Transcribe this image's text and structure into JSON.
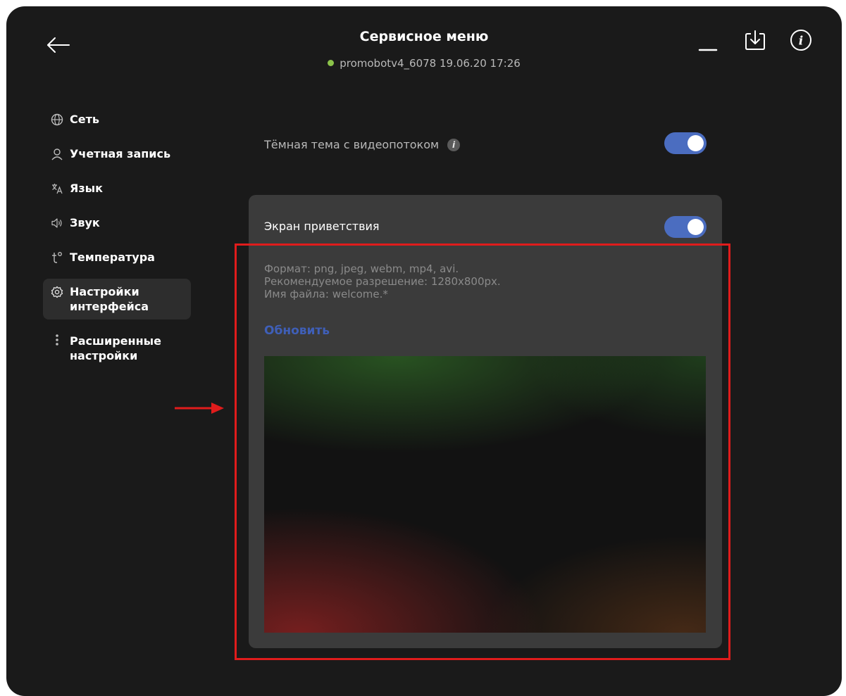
{
  "header": {
    "title": "Сервисное меню",
    "status_dot_color": "#8bc34a",
    "device_status": "promobotv4_6078 19.06.20  17:26",
    "icons": [
      "back-arrow-icon",
      "minimize-icon",
      "download-icon",
      "info-icon"
    ]
  },
  "sidebar": {
    "items": [
      {
        "label": "Сеть",
        "icon": "globe-icon",
        "active": false
      },
      {
        "label": "Учетная запись",
        "icon": "user-icon",
        "active": false
      },
      {
        "label": "Язык",
        "icon": "translate-icon",
        "active": false
      },
      {
        "label": "Звук",
        "icon": "speaker-icon",
        "active": false
      },
      {
        "label": "Температура",
        "icon": "temperature-icon",
        "active": false
      },
      {
        "label": "Настройки\nинтерфейса",
        "icon": "gear-icon",
        "active": true
      },
      {
        "label": "Расширенные\nнастройки",
        "icon": "more-vertical-icon",
        "active": false
      }
    ]
  },
  "settings": {
    "dark_theme": {
      "label": "Тёмная тема с видеопотоком",
      "info_glyph": "i",
      "enabled": true
    },
    "welcome_screen": {
      "label": "Экран приветствия",
      "enabled": true,
      "format_line": "Формат: png, jpeg, webm, mp4, avi.",
      "resolution_line": "Рекомендуемое разрешение: 1280x800px.",
      "filename_line": "Имя файла: welcome.*",
      "update_label": "Обновить"
    }
  },
  "colors": {
    "background": "#1a1a1a",
    "card": "#3b3b3b",
    "accent": "#4b6dc0",
    "link": "#3f5fb8",
    "annotation": "#e01c1c"
  }
}
